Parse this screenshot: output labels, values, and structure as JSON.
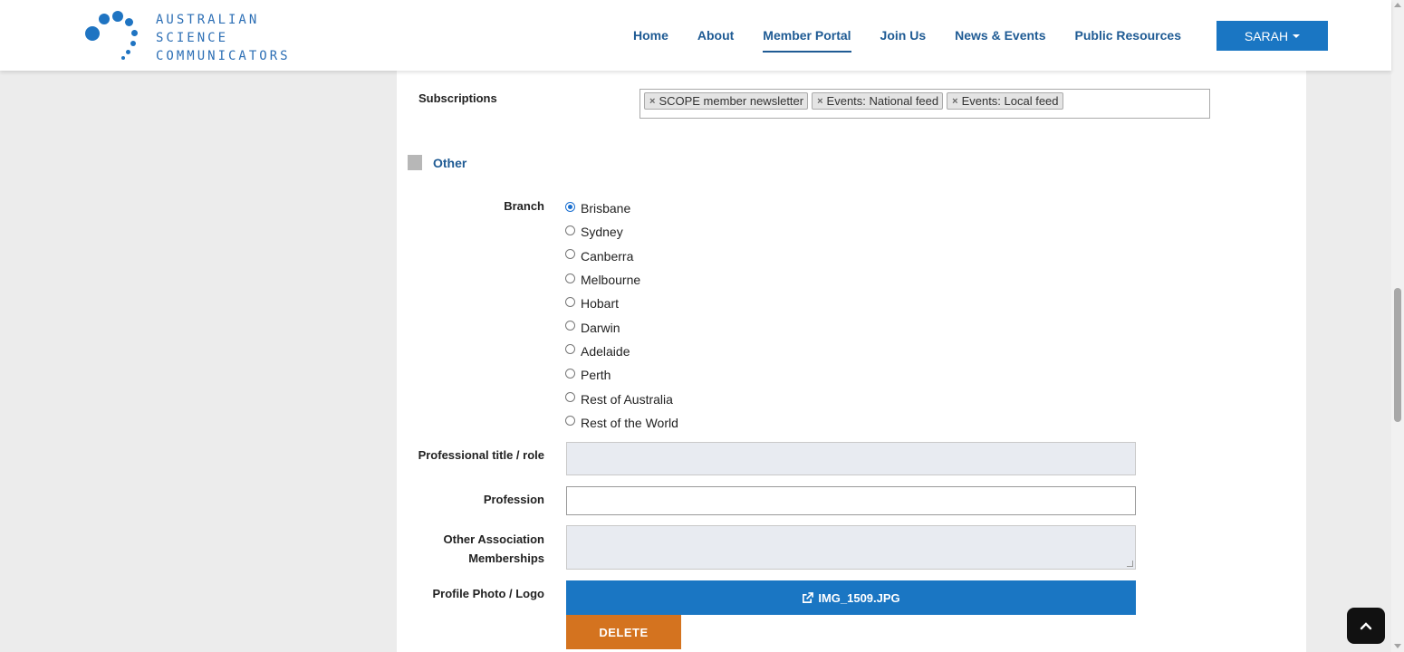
{
  "brand": {
    "line1": "AUSTRALIAN",
    "line2": "SCIENCE",
    "line3": "COMMUNICATORS",
    "color": "#1f74c2"
  },
  "nav": {
    "items": [
      "Home",
      "About",
      "Member Portal",
      "Join Us",
      "News & Events",
      "Public Resources"
    ],
    "active": "Member Portal",
    "user_label": "SARAH"
  },
  "form": {
    "subscriptions": {
      "label": "Subscriptions",
      "tags": [
        "SCOPE member newsletter",
        "Events: National feed",
        "Events: Local feed"
      ]
    },
    "section_title": "Other",
    "branch": {
      "label": "Branch",
      "options": [
        "Brisbane",
        "Sydney",
        "Canberra",
        "Melbourne",
        "Hobart",
        "Darwin",
        "Adelaide",
        "Perth",
        "Rest of Australia",
        "Rest of the World"
      ],
      "selected": "Brisbane"
    },
    "professional_title": {
      "label": "Professional title / role",
      "value": ""
    },
    "profession": {
      "label": "Profession",
      "value": ""
    },
    "other_memberships": {
      "label_line1": "Other Association",
      "label_line2": "Memberships",
      "value": ""
    },
    "profile_photo": {
      "label": "Profile Photo / Logo",
      "file_name": "IMG_1509.JPG",
      "delete_label": "DELETE"
    }
  },
  "colors": {
    "primary": "#1a76c3",
    "nav_text": "#1f5b94",
    "delete": "#d4731f"
  }
}
